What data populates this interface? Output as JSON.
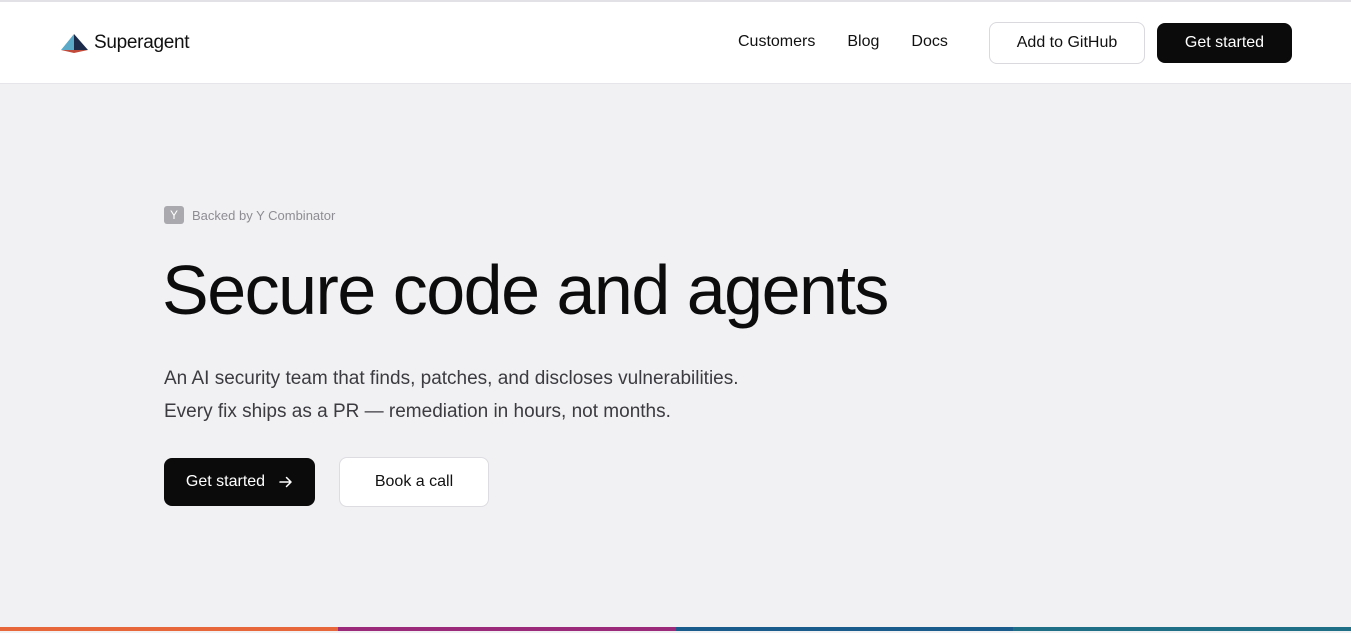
{
  "header": {
    "brand": {
      "name": "Superagent",
      "logo_icon": "pyramid-logo-icon"
    },
    "nav": [
      {
        "label": "Customers"
      },
      {
        "label": "Blog"
      },
      {
        "label": "Docs"
      }
    ],
    "github_button_label": "Add to GitHub",
    "get_started_label": "Get started"
  },
  "hero": {
    "badge": {
      "icon_letter": "Y",
      "icon": "y-combinator-icon",
      "text": "Backed by Y Combinator"
    },
    "title": "Secure code and agents",
    "subtitle_lines": [
      "An AI security team that finds, patches, and discloses vulnerabilities.",
      "Every fix ships as a PR — remediation in hours, not months."
    ],
    "primary_cta": {
      "label": "Get started",
      "icon": "arrow-right-icon"
    },
    "secondary_cta": {
      "label": "Book a call"
    }
  },
  "colors": {
    "primary_button": "#0b0b0c",
    "page_background": "#f1f1f3",
    "header_background": "#ffffff",
    "strip": [
      "#e8673a",
      "#9b2a7a",
      "#1a5d8c",
      "#1f6f86"
    ]
  }
}
